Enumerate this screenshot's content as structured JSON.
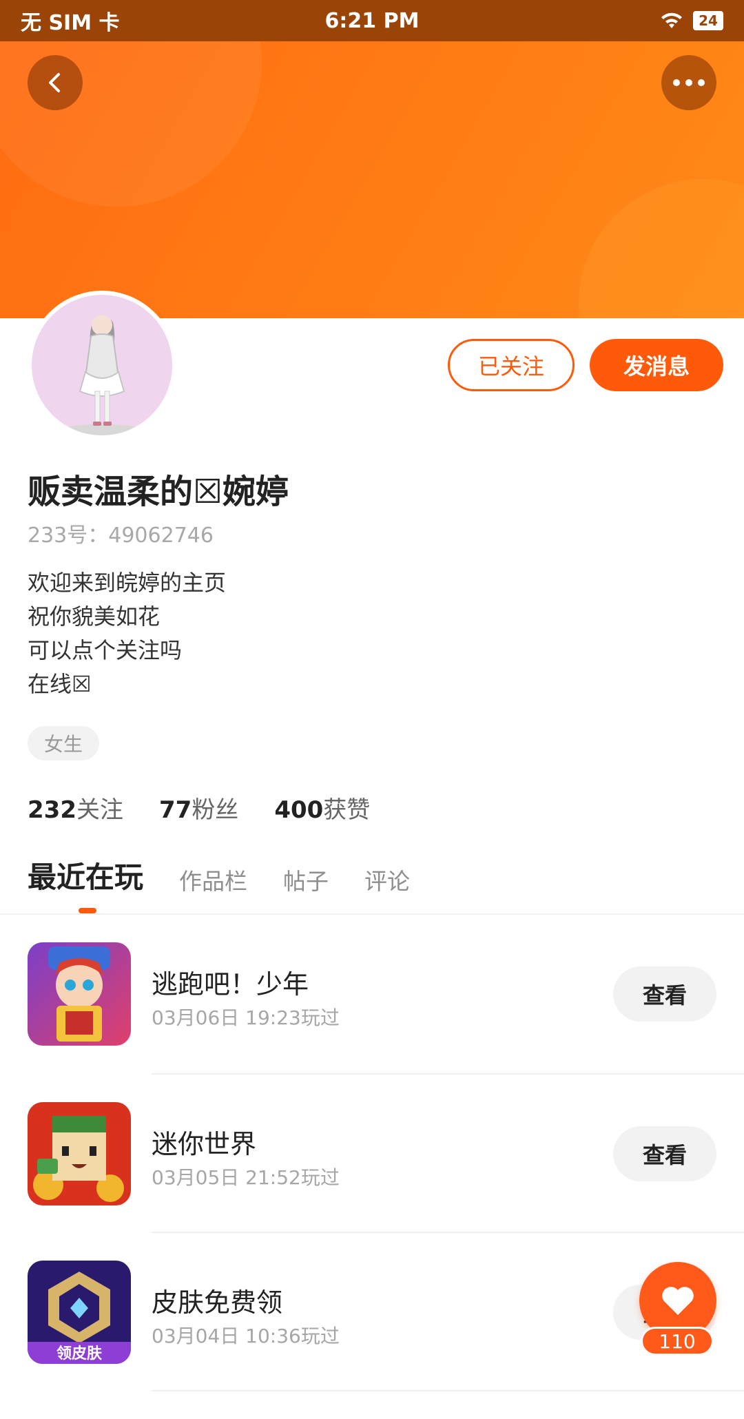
{
  "status_bar": {
    "carrier": "无 SIM 卡",
    "time": "6:21 PM",
    "battery": "24"
  },
  "profile": {
    "name": "贩卖温柔的☒婉婷",
    "uid": "233号：49062746",
    "bio": [
      "欢迎来到皖婷的主页",
      "祝你貌美如花",
      "可以点个关注吗",
      "在线☒"
    ],
    "tag": "女生",
    "follow_label": "已关注",
    "message_label": "发消息"
  },
  "stats": [
    {
      "num": "232",
      "label": "关注"
    },
    {
      "num": "77",
      "label": "粉丝"
    },
    {
      "num": "400",
      "label": "获赞"
    }
  ],
  "tabs": [
    "最近在玩",
    "作品栏",
    "帖子",
    "评论"
  ],
  "games": [
    {
      "title": "逃跑吧！少年",
      "time": "03月06日 19:23玩过",
      "action": "查看",
      "icon": "game-escape-icon"
    },
    {
      "title": "迷你世界",
      "time": "03月05日 21:52玩过",
      "action": "查看",
      "icon": "game-miniworld-icon"
    },
    {
      "title": "皮肤免费领",
      "time": "03月04日 10:36玩过",
      "action": "查看",
      "icon": "game-skin-icon",
      "icon_text": "领皮肤"
    }
  ],
  "likes": {
    "count": "110"
  },
  "colors": {
    "brand": "#ff5a0a",
    "banner": "#ff7c14"
  }
}
